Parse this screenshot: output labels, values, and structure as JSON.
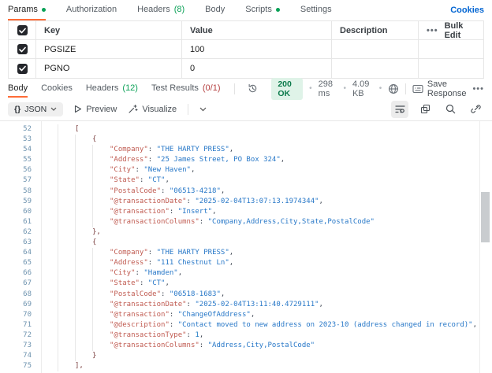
{
  "colors": {
    "accent": "#ff6c37",
    "green": "#0aa157",
    "fail": "#b54040",
    "link": "#0265d2",
    "statusbg": "#dff3e8",
    "statusfg": "#0b7a4b",
    "keycol": "#c05b51",
    "strcol": "#2878c8",
    "numcol": "#1f7bc4",
    "bracecol": "#7a3e3e",
    "punctcol": "#3f4753",
    "lineno": "#6e93af",
    "guide": "#e8e8e8",
    "border": "#e6e6e6"
  },
  "request_tabs": {
    "items": [
      {
        "label": "Params",
        "dot": true,
        "active": true
      },
      {
        "label": "Authorization"
      },
      {
        "label": "Headers",
        "count": "(8)"
      },
      {
        "label": "Body"
      },
      {
        "label": "Scripts",
        "dot": true
      },
      {
        "label": "Settings"
      }
    ],
    "cookies_link": "Cookies"
  },
  "params_table": {
    "columns": {
      "key": "Key",
      "value": "Value",
      "description": "Description"
    },
    "bulk_edit_label": "Bulk Edit",
    "rows": [
      {
        "checked": true,
        "key": "PGSIZE",
        "value": "100",
        "description": ""
      },
      {
        "checked": true,
        "key": "PGNO",
        "value": "0",
        "description": ""
      }
    ]
  },
  "response": {
    "tabs": [
      {
        "label": "Body",
        "active": true
      },
      {
        "label": "Cookies"
      },
      {
        "label": "Headers",
        "count": "(12)",
        "count_color": "green"
      },
      {
        "label": "Test Results",
        "count": "(0/1)",
        "count_color": "fail"
      }
    ],
    "status": "200 OK",
    "time": "298 ms",
    "size": "4.09 KB",
    "save_label": "Save Response",
    "toolbar": {
      "format_label": "JSON",
      "braces_glyph": "{}",
      "preview_label": "Preview",
      "visualize_label": "Visualize"
    }
  },
  "code": {
    "first_line": 52,
    "lines": [
      {
        "n": 52,
        "d": 2,
        "t": [
          [
            "b",
            "["
          ]
        ]
      },
      {
        "n": 53,
        "d": 3,
        "t": [
          [
            "b",
            "{"
          ]
        ]
      },
      {
        "n": 54,
        "d": 4,
        "t": [
          [
            "k",
            "\"Company\""
          ],
          [
            "o",
            ": "
          ],
          [
            "s",
            "\"THE HARTY PRESS\""
          ],
          [
            "o",
            ","
          ]
        ]
      },
      {
        "n": 55,
        "d": 4,
        "t": [
          [
            "k",
            "\"Address\""
          ],
          [
            "o",
            ": "
          ],
          [
            "s",
            "\"25 James Street, PO Box 324\""
          ],
          [
            "o",
            ","
          ]
        ]
      },
      {
        "n": 56,
        "d": 4,
        "t": [
          [
            "k",
            "\"City\""
          ],
          [
            "o",
            ": "
          ],
          [
            "s",
            "\"New Haven\""
          ],
          [
            "o",
            ","
          ]
        ]
      },
      {
        "n": 57,
        "d": 4,
        "t": [
          [
            "k",
            "\"State\""
          ],
          [
            "o",
            ": "
          ],
          [
            "s",
            "\"CT\""
          ],
          [
            "o",
            ","
          ]
        ]
      },
      {
        "n": 58,
        "d": 4,
        "t": [
          [
            "k",
            "\"PostalCode\""
          ],
          [
            "o",
            ": "
          ],
          [
            "s",
            "\"06513-4218\""
          ],
          [
            "o",
            ","
          ]
        ]
      },
      {
        "n": 59,
        "d": 4,
        "t": [
          [
            "k",
            "\"@transactionDate\""
          ],
          [
            "o",
            ": "
          ],
          [
            "s",
            "\"2025-02-04T13:07:13.1974344\""
          ],
          [
            "o",
            ","
          ]
        ]
      },
      {
        "n": 60,
        "d": 4,
        "t": [
          [
            "k",
            "\"@transaction\""
          ],
          [
            "o",
            ": "
          ],
          [
            "s",
            "\"Insert\""
          ],
          [
            "o",
            ","
          ]
        ]
      },
      {
        "n": 61,
        "d": 4,
        "t": [
          [
            "k",
            "\"@transactionColumns\""
          ],
          [
            "o",
            ": "
          ],
          [
            "s",
            "\"Company,Address,City,State,PostalCode\""
          ]
        ]
      },
      {
        "n": 62,
        "d": 3,
        "t": [
          [
            "b",
            "},"
          ]
        ]
      },
      {
        "n": 63,
        "d": 3,
        "t": [
          [
            "b",
            "{"
          ]
        ]
      },
      {
        "n": 64,
        "d": 4,
        "t": [
          [
            "k",
            "\"Company\""
          ],
          [
            "o",
            ": "
          ],
          [
            "s",
            "\"THE HARTY PRESS\""
          ],
          [
            "o",
            ","
          ]
        ]
      },
      {
        "n": 65,
        "d": 4,
        "t": [
          [
            "k",
            "\"Address\""
          ],
          [
            "o",
            ": "
          ],
          [
            "s",
            "\"111 Chestnut Ln\""
          ],
          [
            "o",
            ","
          ]
        ]
      },
      {
        "n": 66,
        "d": 4,
        "t": [
          [
            "k",
            "\"City\""
          ],
          [
            "o",
            ": "
          ],
          [
            "s",
            "\"Hamden\""
          ],
          [
            "o",
            ","
          ]
        ]
      },
      {
        "n": 67,
        "d": 4,
        "t": [
          [
            "k",
            "\"State\""
          ],
          [
            "o",
            ": "
          ],
          [
            "s",
            "\"CT\""
          ],
          [
            "o",
            ","
          ]
        ]
      },
      {
        "n": 68,
        "d": 4,
        "t": [
          [
            "k",
            "\"PostalCode\""
          ],
          [
            "o",
            ": "
          ],
          [
            "s",
            "\"06518-1683\""
          ],
          [
            "o",
            ","
          ]
        ]
      },
      {
        "n": 69,
        "d": 4,
        "t": [
          [
            "k",
            "\"@transactionDate\""
          ],
          [
            "o",
            ": "
          ],
          [
            "s",
            "\"2025-02-04T13:11:40.4729111\""
          ],
          [
            "o",
            ","
          ]
        ]
      },
      {
        "n": 70,
        "d": 4,
        "t": [
          [
            "k",
            "\"@transaction\""
          ],
          [
            "o",
            ": "
          ],
          [
            "s",
            "\"ChangeOfAddress\""
          ],
          [
            "o",
            ","
          ]
        ]
      },
      {
        "n": 71,
        "d": 4,
        "t": [
          [
            "k",
            "\"@description\""
          ],
          [
            "o",
            ": "
          ],
          [
            "s",
            "\"Contact moved to new address on 2023-10 (address changed in record)\""
          ],
          [
            "o",
            ","
          ]
        ]
      },
      {
        "n": 72,
        "d": 4,
        "t": [
          [
            "k",
            "\"@transactionType\""
          ],
          [
            "o",
            ": "
          ],
          [
            "n",
            "1"
          ],
          [
            "o",
            ","
          ]
        ]
      },
      {
        "n": 73,
        "d": 4,
        "t": [
          [
            "k",
            "\"@transactionColumns\""
          ],
          [
            "o",
            ": "
          ],
          [
            "s",
            "\"Address,City,PostalCode\""
          ]
        ]
      },
      {
        "n": 74,
        "d": 3,
        "t": [
          [
            "b",
            "}"
          ]
        ]
      },
      {
        "n": 75,
        "d": 2,
        "t": [
          [
            "b",
            "],"
          ]
        ]
      }
    ]
  }
}
